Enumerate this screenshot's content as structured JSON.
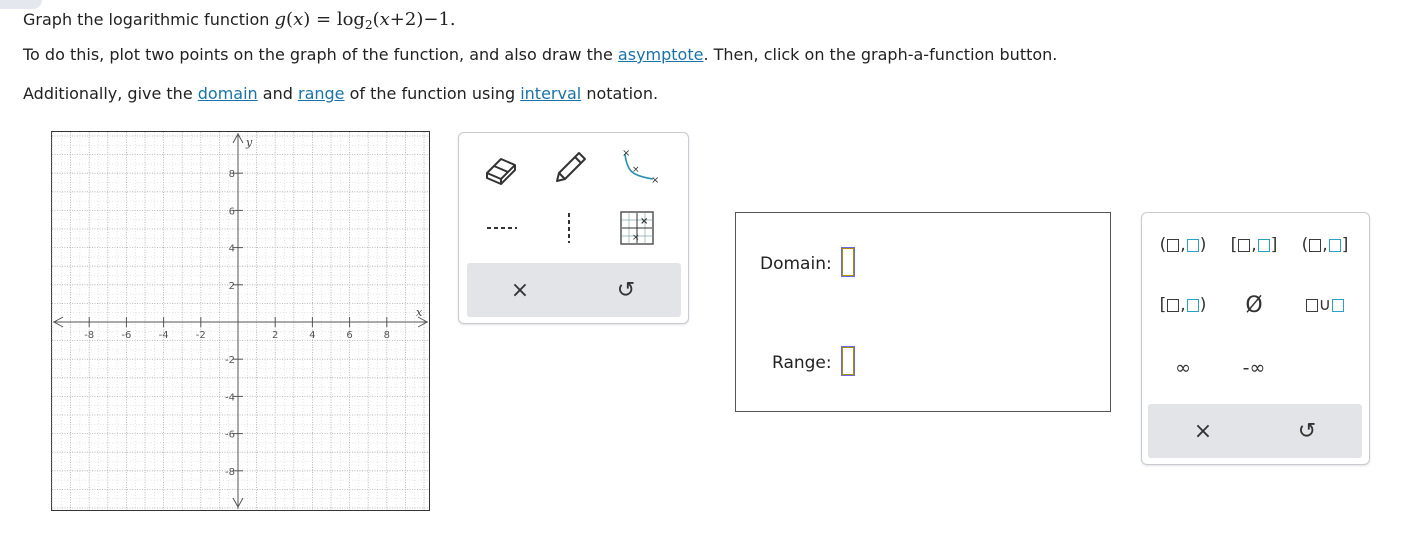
{
  "prompt": {
    "line1_text": "Graph the logarithmic function",
    "line2_pre": "To do this, plot two points on the graph of the function, and also draw the",
    "line2_link": "asymptote",
    "line2_post": ". Then, click on the graph-a-function button.",
    "line3_pre": "Additionally, give the",
    "link_domain": "domain",
    "and_text": "and",
    "link_range": "range",
    "of_text": "of the function using",
    "link_interval": "interval",
    "notation_text": "notation."
  },
  "formula": {
    "g": "g",
    "x": "x",
    "eq": "=",
    "log": "log",
    "base": "2",
    "arg_x": "x",
    "plus": "+",
    "two": "2",
    "minus": "−",
    "one": "1"
  },
  "graph": {
    "x_label": "x",
    "y_label": "y",
    "x_ticks": [
      "-8",
      "-6",
      "-4",
      "-2",
      "2",
      "4",
      "6",
      "8"
    ],
    "y_ticks": [
      "8",
      "6",
      "4",
      "2",
      "-2",
      "-4",
      "-6",
      "-8"
    ],
    "range": [
      -10,
      10
    ]
  },
  "tools": {
    "eraser_icon": "eraser-icon",
    "pencil_icon": "pencil-icon",
    "curve_icon": "log-curve-tool-icon",
    "dashed_h_icon": "horizontal-dashed-line-icon",
    "dashed_v_icon": "vertical-dashed-line-icon",
    "graph_function_icon": "graph-a-function-icon",
    "clear": "×",
    "undo": "↺"
  },
  "answer": {
    "domain_label": "Domain:",
    "range_label": "Range:"
  },
  "keypad": {
    "infinity": "∞",
    "neg_infinity": "-∞",
    "empty_set": "Ø",
    "union": "∪",
    "clear": "×",
    "undo": "↺"
  }
}
